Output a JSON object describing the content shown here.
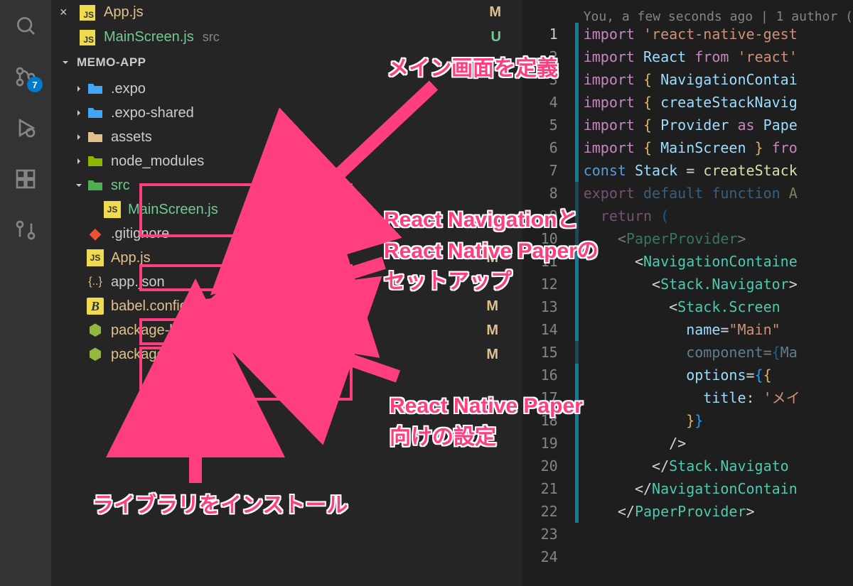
{
  "activity_bar": {
    "icons": [
      "search",
      "source-control",
      "run-debug",
      "extensions",
      "git"
    ],
    "badge_count": "7"
  },
  "open_editors": [
    {
      "name": "App.js",
      "status": "M",
      "status_class": "modified"
    },
    {
      "name": "MainScreen.js",
      "path": "src",
      "status": "U",
      "status_class": "untracked"
    }
  ],
  "explorer": {
    "section_title": "MEMO-APP",
    "items": [
      {
        "type": "folder",
        "name": ".expo",
        "icon": "folder-blue",
        "expanded": false,
        "depth": 1
      },
      {
        "type": "folder",
        "name": ".expo-shared",
        "icon": "folder-blue",
        "expanded": false,
        "depth": 1
      },
      {
        "type": "folder",
        "name": "assets",
        "icon": "folder-yellow",
        "expanded": false,
        "depth": 1
      },
      {
        "type": "folder",
        "name": "node_modules",
        "icon": "folder-green-node",
        "expanded": false,
        "depth": 1
      },
      {
        "type": "folder",
        "name": "src",
        "icon": "folder-green",
        "expanded": true,
        "depth": 1,
        "status_class": "untracked"
      },
      {
        "type": "file",
        "name": "MainScreen.js",
        "icon": "js",
        "depth": 2,
        "status_class": "untracked"
      },
      {
        "type": "file",
        "name": ".gitignore",
        "icon": "git",
        "depth": 1
      },
      {
        "type": "file",
        "name": "App.js",
        "icon": "js",
        "depth": 1,
        "status": "M",
        "status_class": "modified"
      },
      {
        "type": "file",
        "name": "app.json",
        "icon": "json",
        "depth": 1
      },
      {
        "type": "file",
        "name": "babel.config.js",
        "icon": "babel",
        "depth": 1,
        "status": "M",
        "status_class": "modified"
      },
      {
        "type": "file",
        "name": "package-lock.json",
        "icon": "node",
        "depth": 1,
        "status": "M",
        "status_class": "modified"
      },
      {
        "type": "file",
        "name": "package.json",
        "icon": "node",
        "depth": 1,
        "status": "M",
        "status_class": "modified"
      }
    ]
  },
  "editor": {
    "blame": "You, a few seconds ago | 1 author (",
    "lines": [
      {
        "n": 1,
        "html": "<span class='tok-kw'>import</span> <span class='tok-str'>'react-native-gest</span>"
      },
      {
        "n": 2,
        "html": "<span class='tok-kw'>import</span> <span class='tok-var'>React</span> <span class='tok-kw'>from</span> <span class='tok-str'>'react'</span>"
      },
      {
        "n": 3,
        "html": "<span class='tok-kw'>import</span> <span class='tok-brace3'>{</span> <span class='tok-var'>NavigationContai</span>"
      },
      {
        "n": 4,
        "html": "<span class='tok-kw'>import</span> <span class='tok-brace3'>{</span> <span class='tok-var'>createStackNavig</span>"
      },
      {
        "n": 5,
        "html": "<span class='tok-kw'>import</span> <span class='tok-brace3'>{</span> <span class='tok-var'>Provider</span> <span class='tok-kw'>as</span> <span class='tok-var'>Pape</span>"
      },
      {
        "n": 6,
        "html": "<span class='tok-kw'>import</span> <span class='tok-brace3'>{</span> <span class='tok-var'>MainScreen</span> <span class='tok-brace3'>}</span> <span class='tok-kw'>fro</span>"
      },
      {
        "n": 7,
        "html": ""
      },
      {
        "n": 8,
        "html": "<span class='tok-const'>const</span> <span class='tok-var'>Stack</span> <span class='tok-op'>=</span> <span class='tok-func'>createStack</span>"
      },
      {
        "n": 9,
        "html": ""
      },
      {
        "n": 10,
        "html": "<span class='tok-kw'>export</span> <span class='tok-const'>default</span> <span class='tok-const'>function</span> <span class='tok-func'>A</span>",
        "dim": true
      },
      {
        "n": 11,
        "html": "  <span class='tok-kw'>return</span> <span class='tok-brace2'>(</span>",
        "dim": true
      },
      {
        "n": 12,
        "html": "    <span class='tok-op'>&lt;</span><span class='tok-type'>PaperProvider</span><span class='tok-op'>&gt;</span>",
        "dim": true
      },
      {
        "n": 13,
        "html": "      <span class='tok-op'>&lt;</span><span class='tok-type'>NavigationContaine</span>"
      },
      {
        "n": 14,
        "html": "        <span class='tok-op'>&lt;</span><span class='tok-type'>Stack.Navigator</span><span class='tok-op'>&gt;</span>"
      },
      {
        "n": 15,
        "html": "          <span class='tok-op'>&lt;</span><span class='tok-type'>Stack.Screen</span>"
      },
      {
        "n": 16,
        "html": "            <span class='tok-var'>name</span><span class='tok-op'>=</span><span class='tok-str'>\"Main\"</span>"
      },
      {
        "n": 17,
        "html": "            <span class='tok-var'>component</span><span class='tok-op'>=</span><span class='tok-brace2'>{</span><span class='tok-var'>Ma</span>",
        "dim": true
      },
      {
        "n": 18,
        "html": "            <span class='tok-var'>options</span><span class='tok-op'>=</span><span class='tok-brace2'>{</span><span class='tok-brace3'>{</span>"
      },
      {
        "n": 19,
        "html": "              <span class='tok-var'>title</span><span class='tok-op'>:</span> <span class='tok-str'>'メイ</span>"
      },
      {
        "n": 20,
        "html": "            <span class='tok-brace3'>}</span><span class='tok-brace2'>}</span>"
      },
      {
        "n": 21,
        "html": "          <span class='tok-op'>/&gt;</span>"
      },
      {
        "n": 22,
        "html": "        <span class='tok-op'>&lt;/</span><span class='tok-type'>Stack.Navigato</span>"
      },
      {
        "n": 23,
        "html": "      <span class='tok-op'>&lt;/</span><span class='tok-type'>NavigationContain</span>"
      },
      {
        "n": 24,
        "html": "    <span class='tok-op'>&lt;/</span><span class='tok-type'>PaperProvider</span><span class='tok-op'>&gt;</span>"
      }
    ]
  },
  "annotations": {
    "a1": "メイン画面を定義",
    "a2": "React Navigationと\nReact Native Paperの\nセットアップ",
    "a3": "React Native Paper\n向けの設定",
    "a4": "ライブラリをインストール"
  }
}
